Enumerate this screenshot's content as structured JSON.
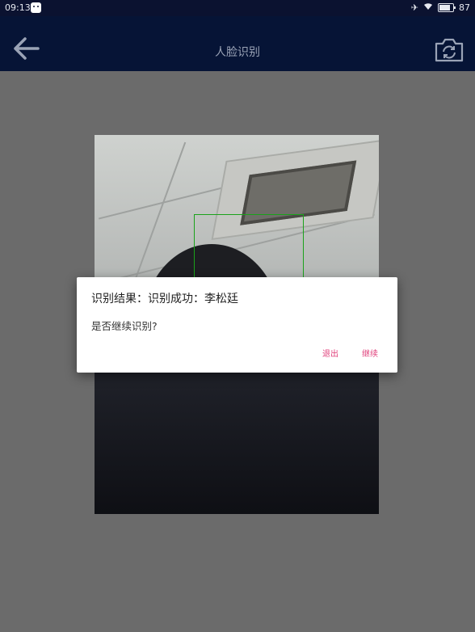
{
  "status_bar": {
    "time": "09:13",
    "battery_level": "87",
    "icons": [
      "app-notification-icon",
      "airplane-icon",
      "wifi-icon",
      "battery-icon"
    ]
  },
  "toolbar": {
    "title": "人脸识别",
    "back_icon": "arrow-left-icon",
    "switch_camera_icon": "camera-switch-icon"
  },
  "camera_preview": {
    "face_box_color": "#1aa21a"
  },
  "dialog": {
    "title": "识别结果：识别成功：李松廷",
    "message": "是否继续识别?",
    "exit_label": "退出",
    "continue_label": "继续",
    "button_color": "#e0407b"
  },
  "colors": {
    "toolbar_bg": "#061436",
    "screen_bg": "#6b6b6b"
  }
}
